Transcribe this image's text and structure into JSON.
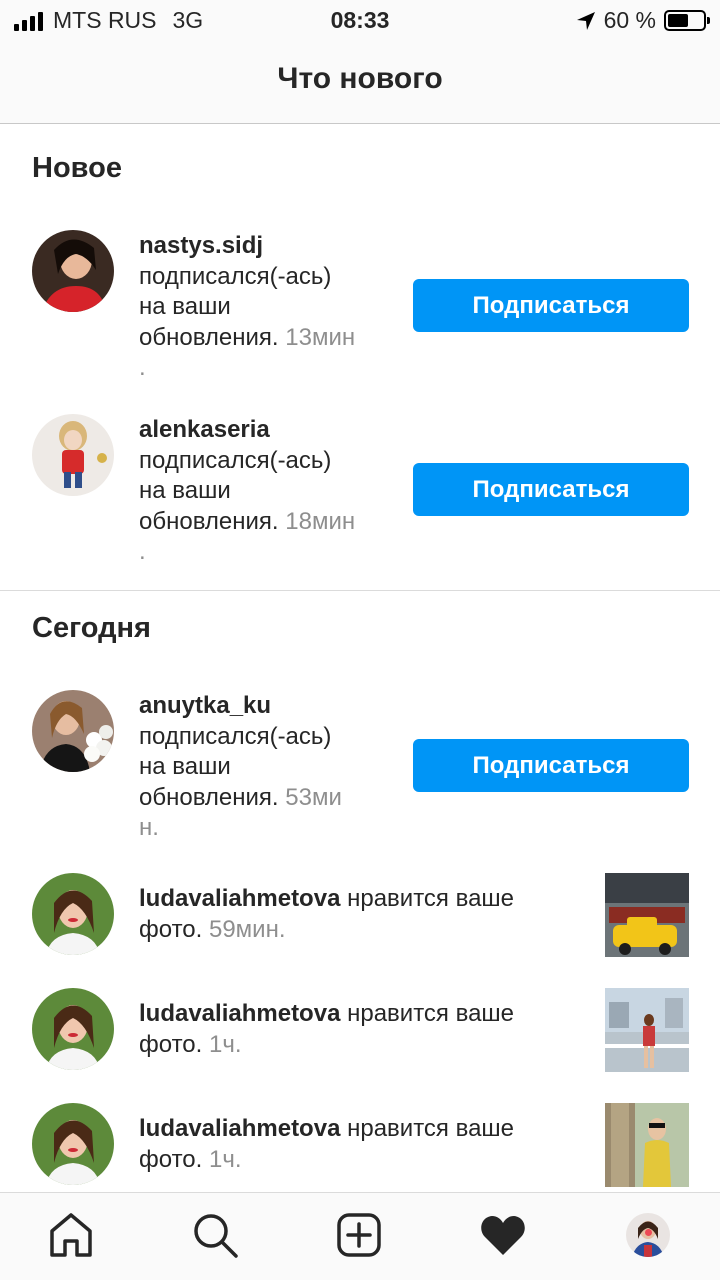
{
  "status_bar": {
    "carrier": "MTS RUS",
    "network": "3G",
    "time": "08:33",
    "battery": "60 %",
    "battery_level": 0.6
  },
  "header": {
    "title": "Что нового"
  },
  "sections": {
    "new_title": "Новое",
    "today_title": "Сегодня"
  },
  "notifications": [
    {
      "user": "nastys.sidj",
      "line1": "подписался(-ась)",
      "line2": "на ваши",
      "line3": "обновления.",
      "time": "13мин",
      "line4": ".",
      "button": "Подписаться"
    },
    {
      "user": "alenkaseria",
      "line1": "подписался(-ась)",
      "line2": "на ваши",
      "line3": "обновления.",
      "time": "18мин",
      "line4": ".",
      "button": "Подписаться"
    },
    {
      "user": "anuytka_ku",
      "line1": "подписался(-ась)",
      "line2": "на ваши",
      "line3": "обновления.",
      "time": "53ми",
      "line4": "н.",
      "button": "Подписаться"
    },
    {
      "user": "ludavaliahmetova",
      "action": "нравится ваше",
      "line2": "фото.",
      "time": "59мин."
    },
    {
      "user": "ludavaliahmetova",
      "action": "нравится ваше",
      "line2": "фото.",
      "time": "1ч."
    },
    {
      "user": "ludavaliahmetova",
      "action": "нравится ваше",
      "line2": "фото.",
      "time": "1ч."
    }
  ],
  "tabs": [
    "home-icon",
    "search-icon",
    "add-post-icon",
    "heart-icon",
    "profile-avatar"
  ],
  "colors": {
    "accent": "#0095f6",
    "notification_dot": "#ed4956"
  }
}
